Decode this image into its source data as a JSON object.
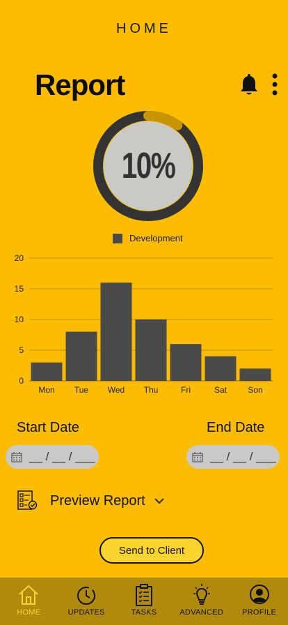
{
  "header": {
    "title": "HOME"
  },
  "report": {
    "title": "Report"
  },
  "progress": {
    "label": "10%",
    "value": 0.1,
    "track_color": "#333333",
    "fill_color": "#c69500",
    "inner_color": "#c9c9c5"
  },
  "legend": {
    "label": "Development",
    "color": "#4a4a4a"
  },
  "chart_data": {
    "type": "bar",
    "categories": [
      "Mon",
      "Tue",
      "Wed",
      "Thu",
      "Fri",
      "Sat",
      "Son"
    ],
    "series": [
      {
        "name": "Development",
        "values": [
          3,
          8,
          16,
          10,
          6,
          4,
          2
        ]
      }
    ],
    "ylim": [
      0,
      20
    ],
    "yticks": [
      0,
      5,
      10,
      15,
      20
    ],
    "grid": true,
    "legend_position": "top-center",
    "bar_color": "#4a4a4a",
    "grid_color": "#c08d00"
  },
  "dates": {
    "start_label": "Start Date",
    "end_label": "End Date",
    "start_value": "__ / __ / ___",
    "end_value": "__ / __ / ___"
  },
  "preview": {
    "label": "Preview Report"
  },
  "send": {
    "label": "Send to Client"
  },
  "nav": {
    "items": [
      {
        "label": "HOME",
        "icon": "home-icon",
        "active": true
      },
      {
        "label": "UPDATES",
        "icon": "clock-icon"
      },
      {
        "label": "TASKS",
        "icon": "clipboard-icon"
      },
      {
        "label": "ADVANCED",
        "icon": "lightbulb-icon"
      },
      {
        "label": "PROFILE",
        "icon": "user-icon"
      }
    ]
  },
  "colors": {
    "background": "#fcbc00",
    "nav_background": "#b08a0c",
    "active_nav": "#fcd42e"
  }
}
